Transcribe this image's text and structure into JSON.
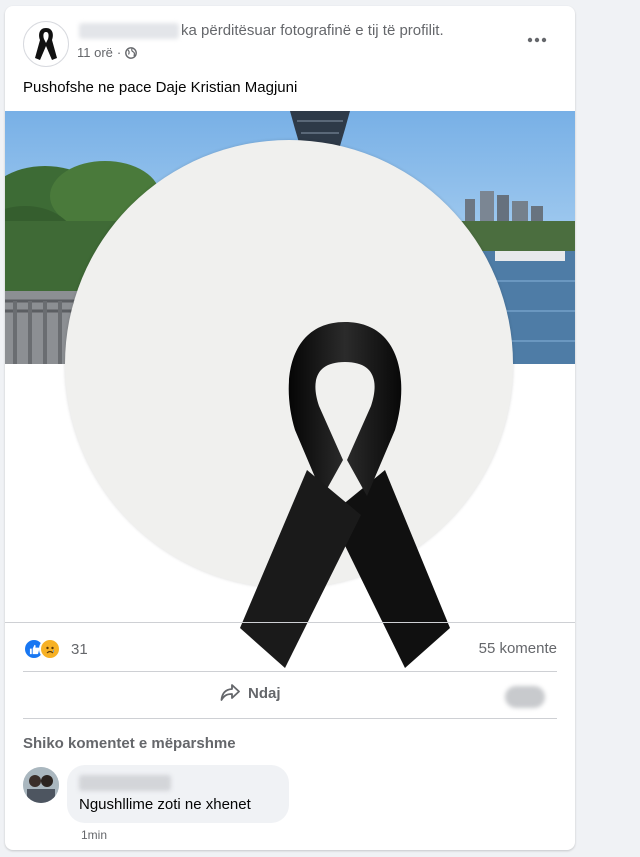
{
  "post": {
    "action_text": "ka përditësuar fotografinë e tij të profilit.",
    "time": "11 orë",
    "separator": "·",
    "privacy_icon": "globe-icon",
    "more_icon": "more-options-icon",
    "caption": "Pushofshe ne pace Daje Kristian Magjuni"
  },
  "reactions": {
    "icons": [
      "like-reaction-icon",
      "sad-reaction-icon"
    ],
    "count": "31",
    "comments": "55 komente"
  },
  "actions": {
    "share_label": "Ndaj",
    "share_icon": "share-arrow-icon"
  },
  "comments_section": {
    "view_previous": "Shiko komentet e mëparshme",
    "items": [
      {
        "text": "Ngushllime zoti ne xhenet",
        "time": "1min"
      }
    ]
  },
  "colors": {
    "background": "#f0f2f5",
    "card": "#ffffff",
    "secondary_text": "#65676b",
    "like_blue": "#1877f2",
    "sad_yellow": "#f7b125"
  }
}
